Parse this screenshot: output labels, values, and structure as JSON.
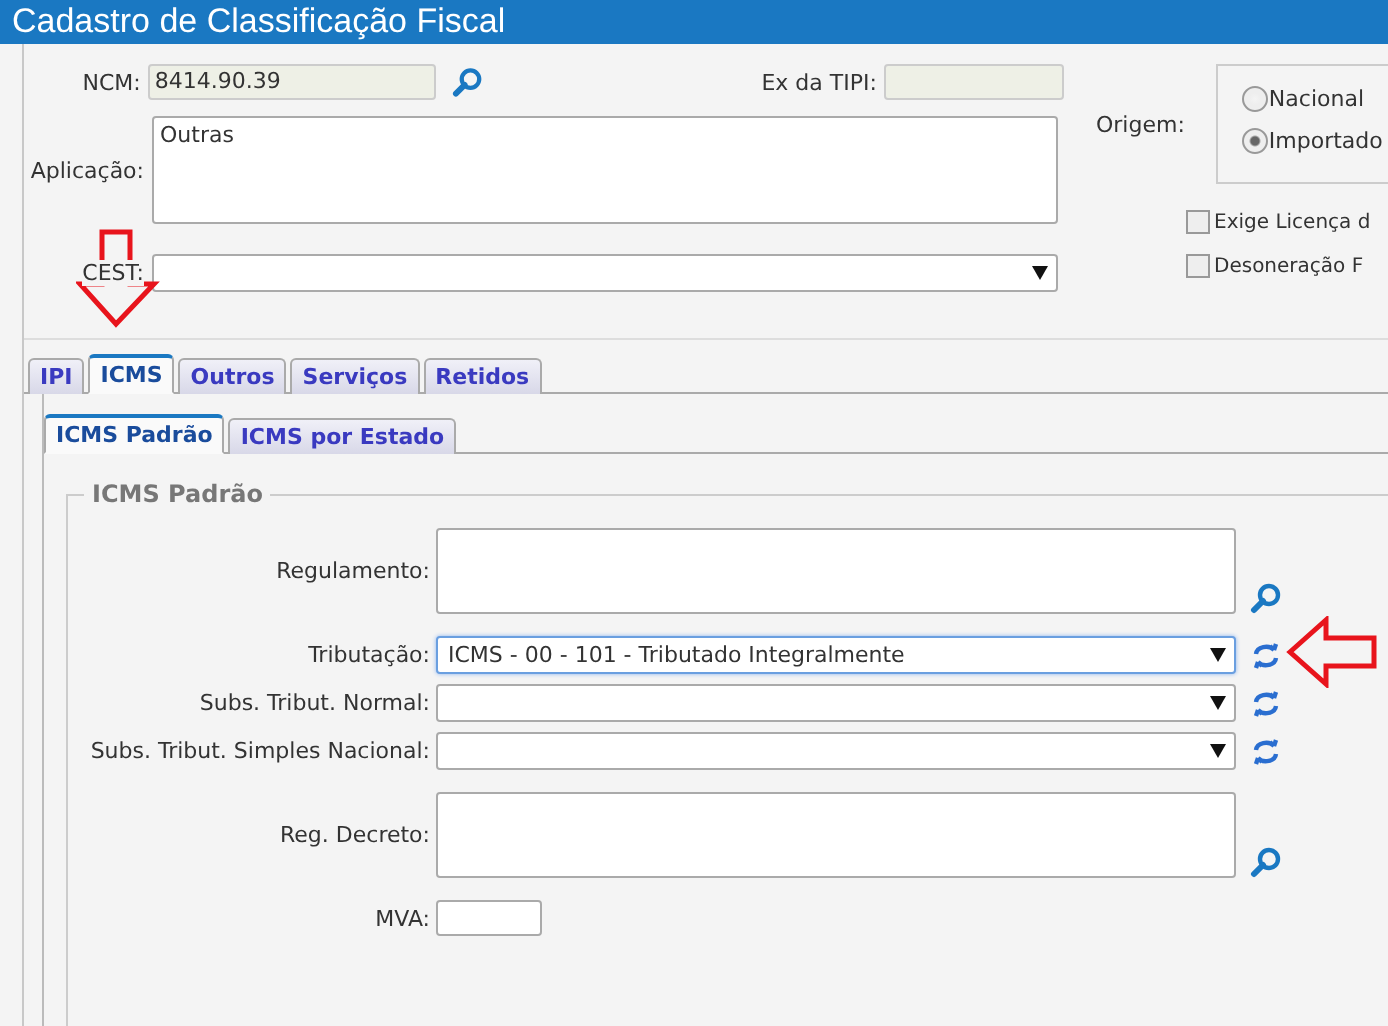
{
  "window": {
    "title": "Cadastro de Classificação Fiscal"
  },
  "ncm": {
    "label": "NCM:",
    "value": "8414.90.39"
  },
  "ex_tipi": {
    "label": "Ex da TIPI:"
  },
  "aplicacao": {
    "label": "Aplicação:",
    "value": "Outras"
  },
  "cest": {
    "label": "CEST:"
  },
  "origem": {
    "label": "Origem:",
    "options": [
      {
        "label": "Nacional",
        "selected": false
      },
      {
        "label": "Importado",
        "selected": true
      }
    ]
  },
  "checkboxes": [
    {
      "label": "Exige Licença d",
      "checked": false
    },
    {
      "label": "Desoneração F",
      "checked": false
    }
  ],
  "tabs": [
    {
      "label": "IPI",
      "selected": false
    },
    {
      "label": "ICMS",
      "selected": true
    },
    {
      "label": "Outros",
      "selected": false
    },
    {
      "label": "Serviços",
      "selected": false
    },
    {
      "label": "Retidos",
      "selected": false
    }
  ],
  "subtabs": [
    {
      "label": "ICMS Padrão",
      "selected": true
    },
    {
      "label": "ICMS por Estado",
      "selected": false
    }
  ],
  "fieldset": {
    "legend": "ICMS Padrão",
    "fields": [
      {
        "kind": "textarea",
        "label": "Regulamento:"
      },
      {
        "kind": "select",
        "label": "Tributação:",
        "value": "ICMS - 00 - 101 - Tributado Integralmente",
        "focused": true
      },
      {
        "kind": "select",
        "label": "Subs. Tribut. Normal:",
        "focused": false
      },
      {
        "kind": "select",
        "label": "Subs. Tribut. Simples Nacional:",
        "focused": false
      },
      {
        "kind": "textarea",
        "label": "Reg. Decreto:"
      },
      {
        "kind": "input",
        "label": "MVA:"
      }
    ]
  }
}
